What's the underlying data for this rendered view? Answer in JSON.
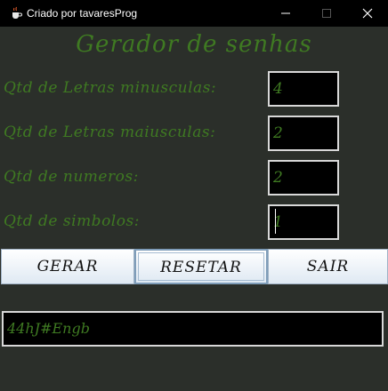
{
  "window": {
    "title": "Criado por tavaresProg",
    "icon": "java-cup-icon",
    "controls": [
      "minimize-icon",
      "maximize-icon",
      "close-icon"
    ]
  },
  "heading": "Gerador de senhas",
  "fields": [
    {
      "label": "Qtd de Letras minusculas:",
      "value": "4"
    },
    {
      "label": "Qtd de Letras maiusculas:",
      "value": "2"
    },
    {
      "label": "Qtd de numeros:",
      "value": "2"
    },
    {
      "label": "Qtd de simbolos:",
      "value": "1"
    }
  ],
  "buttons": {
    "generate": "GERAR",
    "reset": "RESETAR",
    "exit": "SAIR"
  },
  "output": "44hJ#Engb",
  "colors": {
    "background": "#2b2f2a",
    "text_green": "#3f7a22",
    "field_bg": "#000000",
    "titlebar": "#000000"
  }
}
